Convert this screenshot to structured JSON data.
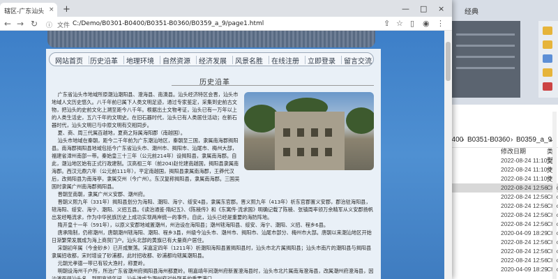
{
  "browser": {
    "tab_title": "辖区-广东汕头",
    "tab_close": "×",
    "new_tab": "+",
    "address_prefix": "文件",
    "address": "C:/Demo/B0301-B0400/B0351-B0360/B0359_a_9/page1.html",
    "window_controls": [
      "—",
      "□",
      "×"
    ],
    "toolbar_icons": [
      "share-icon",
      "star-icon",
      "sidebar-icon",
      "profile-icon",
      "more-icon"
    ]
  },
  "site": {
    "nav": [
      "网站首页",
      "历史沿革",
      "地理环境",
      "自然资源",
      "经济发展",
      "风景名胜",
      "在线注册",
      "立即登录",
      "留言交流"
    ],
    "section_title": "历史沿革",
    "paragraphs": [
      "广东省汕头市地域所原潮汕潮阳县、澄海县、南澳县。汕头经济特区会晋，汕头市地域人文历史悠久。八千年前已属下人类文明足迹，通过专家鉴定，采集到史前古文物，把汕头的史前文化上溯至距今八千年。根据出土文物考证，汕头已有一万年以上的人类生活史，五六千年的文明史。在旧石器时代，汕头已有人类居住活动；在新石器时代，汕头文明已与中原文明有交相同步。",
      "夏、商、周三代属百越地，夏商之际属海阳郡（南越国）。",
      "汕头市地域在秦朝，距今二千年前为广东潮汕地区，秦朝至三国，隶属南海郡揭阳县。南海郡揭阳县地域包括今广东省汕头市、潮州市、揭阳市、汕尾市、梅州大部，福建省漳州南部一带。秦始皇三十三年（公元前214年）设揭阳县，隶属南海郡。自此，潮汕地区始有正式行政建制。汉高祖三年（前204)赵佗建南越国，揭阳县隶属南海郡。西汉元鼎六年（公元前111年），平定南越国，揭阳县隶属南海郡，王莽代汉后，改揭阳县为南海亭，隶属交州（今广州）。东汉复称揭阳县，隶属南海郡。三国吴国时隶属广州南海郡揭阳县。",
      "晋朝至南朝，隶属广州义安郡、潮州府。",
      "晋朝义熙九年（331年）揭阳县划分为海阳、潮阳、海宁、绥安4县，隶属东官郡。晋义熙九年（413年）析东官郡置义安郡，郡治驻海阳县，辖海阳、绥安、海宁、潮阳、义招五县。《读治通鉴·隋纪五》、《陈稜传》和《东寓传·流求国》明确记载了陈稜、张镇周率领万余精军从义安郡扬帆出发经略流求，作为中华民族历史上成功实现两岸统一的事件。自此，汕头已经是重要的海防阵地。",
      "隋开皇十一年（591年），以原义安郡地域置潮州，州治设在海阳县；潮州辖海阳县、绥安、海宁、潮阳、义招、程乡6县。",
      "唐承隋制，仍称潮州，唐朝潮州辖海阳、潮阳、程乡3县，州级今汕头市、潮州市、揭阳市、汕尾市部分、梅州市大部。唐朝以来潮汕地区开始日渐繁荣发展成为海上商贸门户。汕头北部的黄旗已有大量商户居住。",
      "宋朝初年属（今金砂乡）已开成聚落。宋嘉定四年（1211年）析潮阳海阳县置揭阳县时，汕头市北片属揭阳县；汕头市南片的潮阳县与揭阳县隶属招收都，宋时增设了砂浦都，此时招收都、砂浦都均辖属潮阳县。",
      "元朝光孝德一带已有较大渔村，称夏岭。",
      "明朝设海州千户所，所治广东省潮州府揭阳县海州都夏岭。明嘉靖年间潮州府新置澄海县时，汕头市北片属南海澄海县，改属潮州府澄海县，因沙滩而得汕头名，到明嘉靖年间，汕头遂成为潮州府对外联系的重要港口。"
    ]
  }
}
